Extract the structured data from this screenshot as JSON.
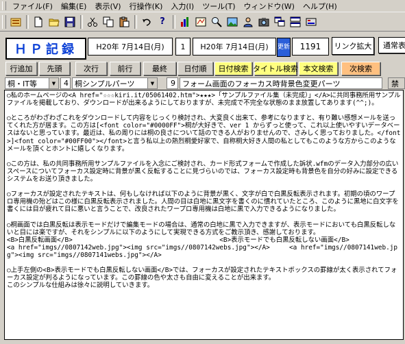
{
  "menu": [
    {
      "label": "ファイル(F)"
    },
    {
      "label": "編集(E)"
    },
    {
      "label": "表示(V)"
    },
    {
      "label": "行操作(K)"
    },
    {
      "label": "入力(I)"
    },
    {
      "label": "ツール(T)"
    },
    {
      "label": "ウィンドウ(W)"
    },
    {
      "label": "ヘルプ(H)"
    }
  ],
  "toolbar_icons": [
    "app-icon",
    "new-file-icon",
    "open-folder-icon",
    "save-icon",
    "cut-icon",
    "copy-icon",
    "paste-icon",
    "undo-icon",
    "help-icon",
    "bar-chart-icon",
    "tools-icon",
    "zoom-icon",
    "image-icon",
    "user-icon",
    "photo-icon",
    "cascade-windows-icon",
    "tile-windows-icon",
    "settings-icon"
  ],
  "header": {
    "title": "ＨＰ記録",
    "date_start": "H20年 7月14日(月)",
    "day_number": "1",
    "date_end": "H20年 7月14日(月)",
    "update_label": "更新",
    "count": "1191",
    "link_expand_label": "リンク拡大",
    "normal_label": "通常表"
  },
  "nav_buttons": [
    {
      "label": "行追加",
      "color": "#d4d0c8"
    },
    {
      "label": "先頭",
      "color": "#d4d0c8"
    },
    {
      "label": "次行",
      "color": "#d4d0c8"
    },
    {
      "label": "前行",
      "color": "#d4d0c8"
    },
    {
      "label": "最終",
      "color": "#d4d0c8"
    },
    {
      "label": "日付順",
      "color": "#d4d0c8"
    },
    {
      "label": "日付検索",
      "color": "#ffff80"
    },
    {
      "label": "タイトル検索",
      "color": "#ffff80"
    },
    {
      "label": "本文検索",
      "color": "#ffff80"
    },
    {
      "label": "次検索",
      "color": "#ffc080"
    }
  ],
  "fields": {
    "category": "桐・IT等",
    "subcategory_num": "4",
    "subcategory": "桐シンプルパーツ",
    "title_num": "9",
    "title": "フォーム画面のフォーカス時背景色変更パーツ",
    "forbid_label": "禁"
  },
  "body_text": "○私のホームページの<A href=\"☆☆☆kiri.it/05061402.htm\">★★★>「サンプルファイル集（未完成）」</A>に共同事務所用サンプルファイルを掲載しており、ダウンロードが出来るようにしておりますが、未完成で不完全な状態のまま放置してあります(^^;)。\n\n○ところがわざわざこれをダウンロードして内容をじっくり検討され、大変良く出来て、参考になりますと、有り難い感想メールを送ってくれた方が居ます。この方は[<font color=\"#0000FF\">桐が大好きで、ver 1 からずっと使って、これ以上使いやすいデータベースはないと思っています。最近は、私の周りには桐の良さについて話のできる人がおりませんので、さみしく思っておりました。</font>]<font color=\"#00FF00\"></font>と言う私以上の熱烈桐愛好家で、自称桐大好き人間の私としてもこのような方からこのようなメールを頂くとホントに嬉しくなります。\n\n○この方は、私の共同事務所用サンプルファイルを入念にご検討され、カード形式フォームで作成した訴状.wfmのデータ入力部分の広いスペースについてフォーカス設定時に背景が黒く反転することに見づらいのでは、フォーカス設定時も背景色を自分の好みに設定できるシステムをお送り頂きました。\n\n○フォーカスが設定されたテキストは、何もしなければ以下のように背景が黒く、文字が白で白黒反転表示されます。初期の頃のワープロ専用機の殆どはこの様に白黒反転表示されました。人間の目は白地に黒文字を書くのに慣れていたところ、このように黒地に白文字を書くには目が疲れて目に悪いと言うことで、改良されたワープロ専用機は白地に黒で入力できるようになりました。\n\n○桐画面では白黒反転は表示モードだけで編集モードの場合は、通常の白地に黒で入力できますが、表示モードにおいても白黒反転しないと目には楽ですが、それをシンプルに以下のようにして実現できる方式をご教示頂き、感謝しております。\n<B>白黒反転画面</B>                                      <B>表示モードでも白黒反転しない画面</B>\n<a href=\"imgs//0807142web.jpg\"><img src=\"imgs//0807142webs.jpg\"></A>     <a href=\"imgs//0807141web.jpg\"><img src=\"imgs//0807141webs.jpg\"></A>\n\n○上手左側の<B>表示モードでも白黒反転しない画面</B>では、フォーカスが設定されたテキストボックスの罫線が太く表示されてフォーカス設定が判るようになっています。この罫線の色や太さも自由に変えることが出来ます。\nこのシンプルな仕組みは徐々に説明していきます。"
}
